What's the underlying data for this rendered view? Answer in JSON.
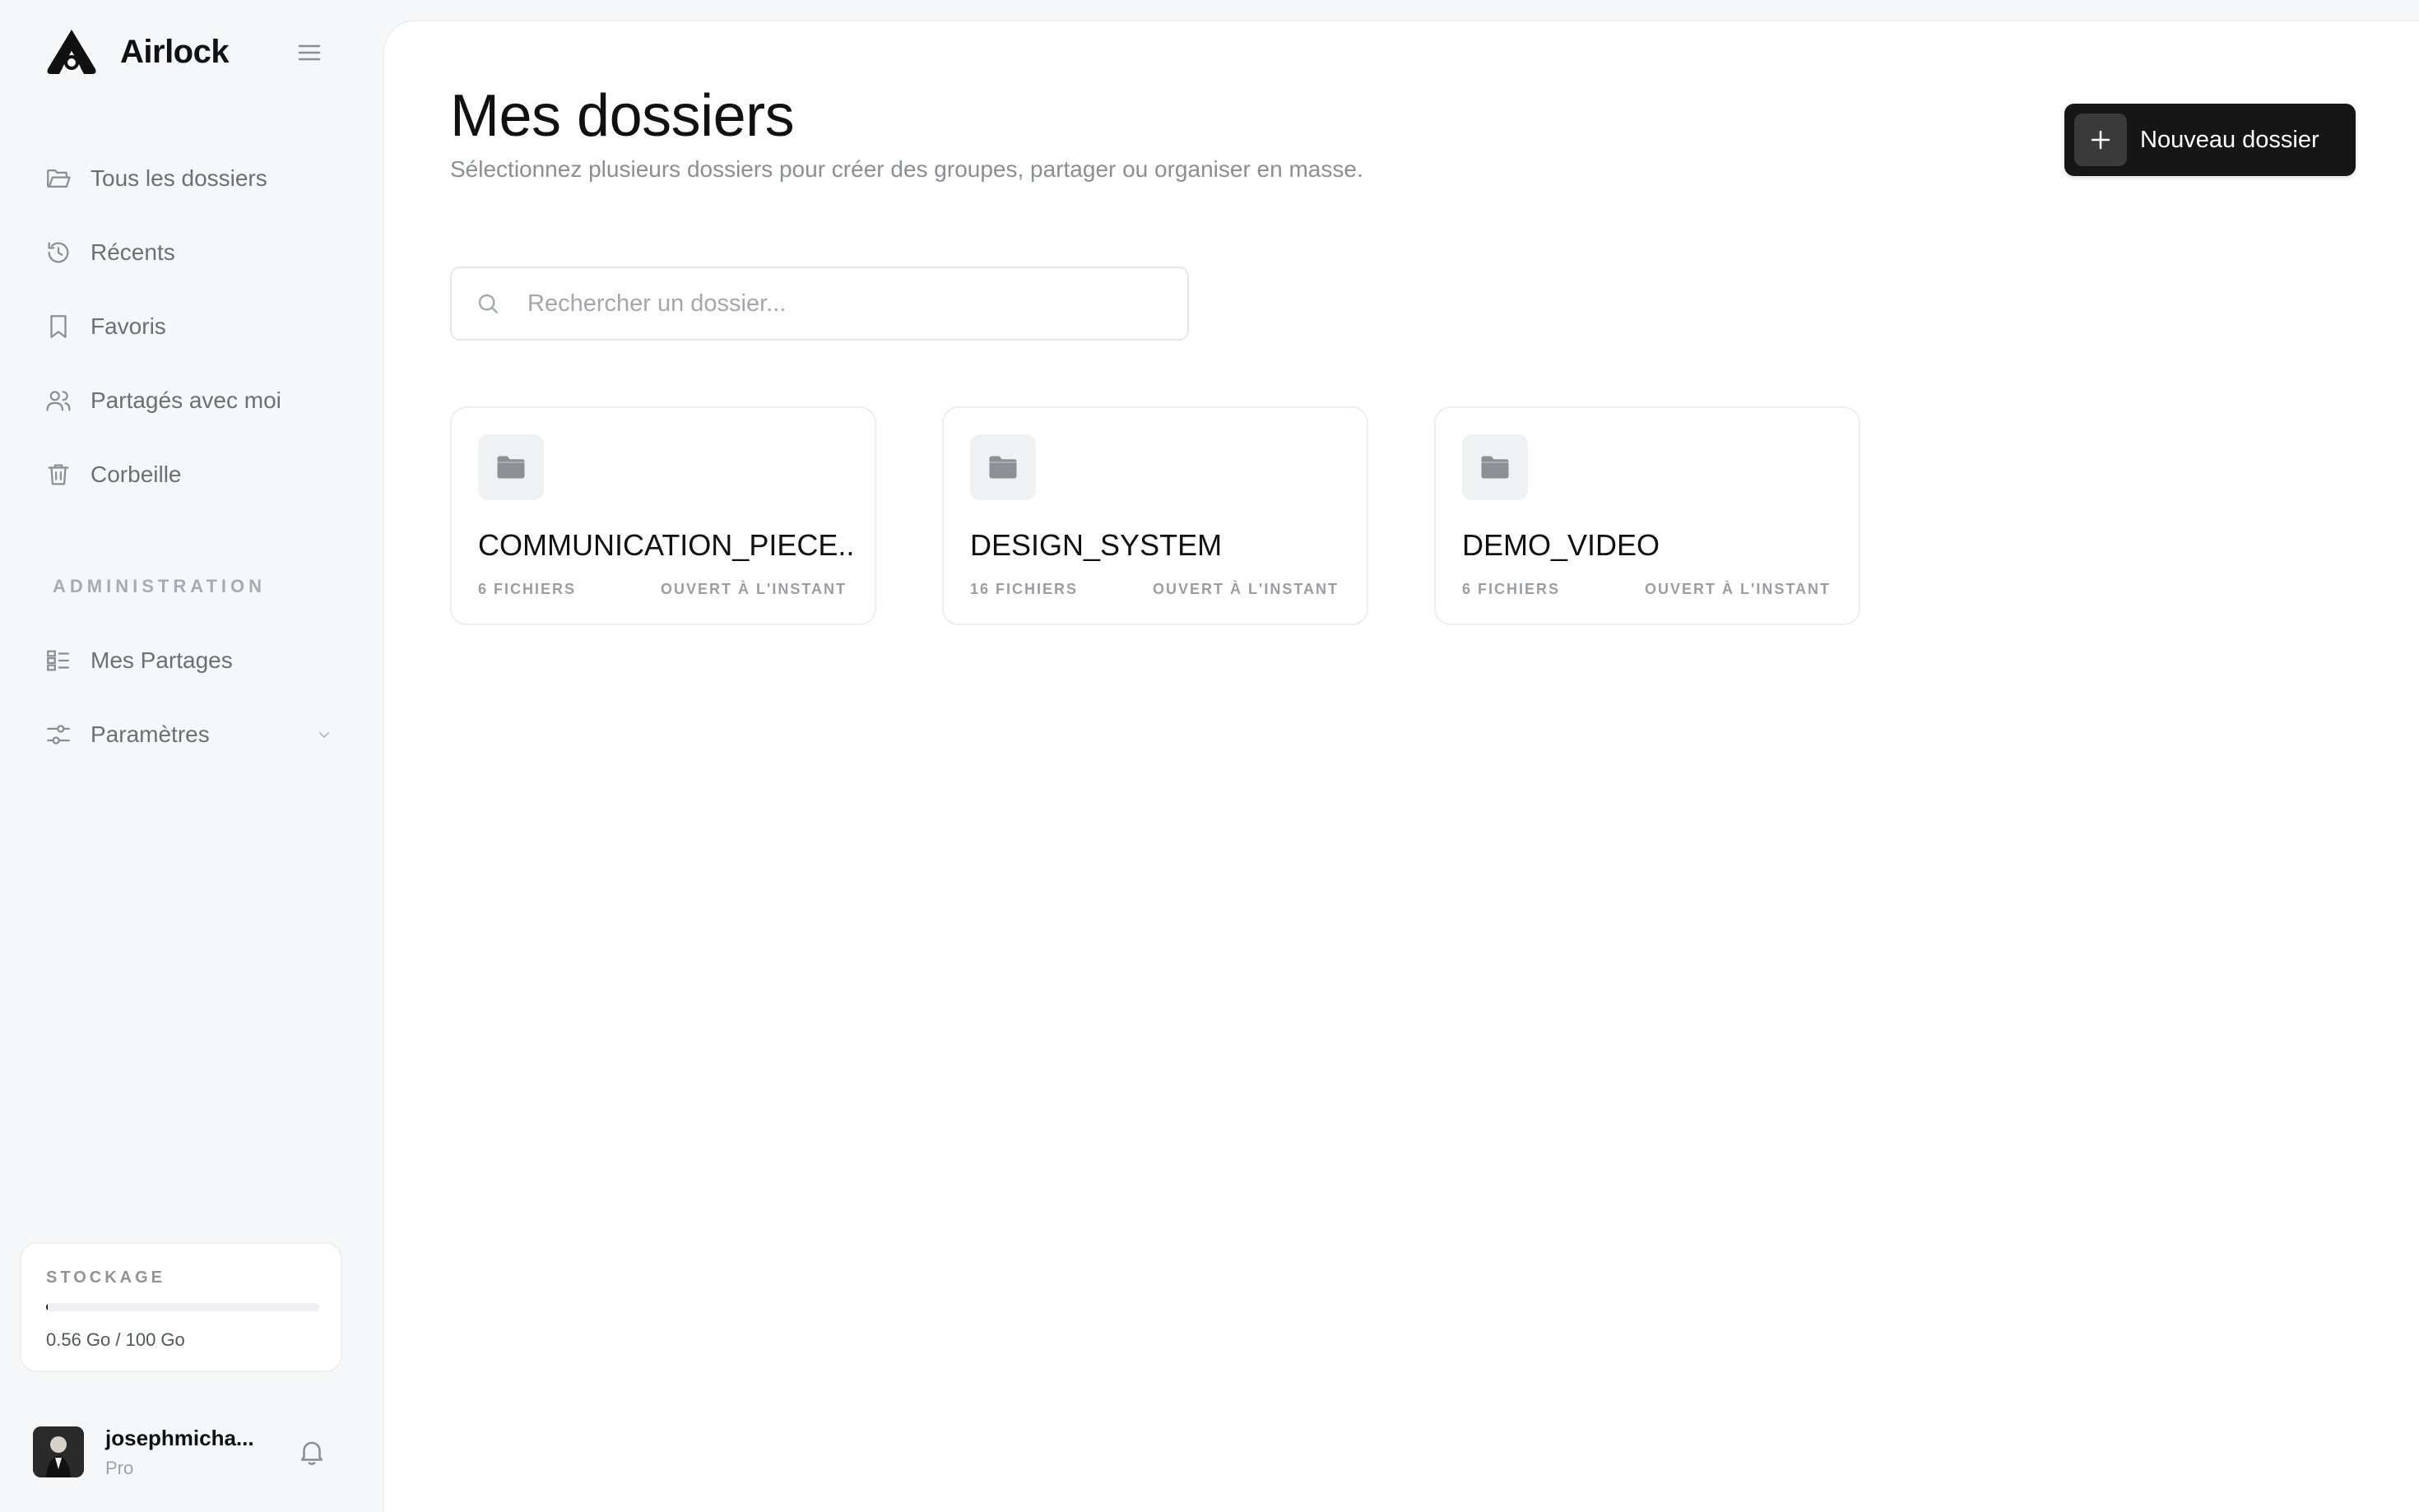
{
  "brand": {
    "name": "Airlock"
  },
  "sidebar": {
    "items": [
      {
        "label": "Tous les dossiers",
        "icon": "folder-open-icon"
      },
      {
        "label": "Récents",
        "icon": "history-icon"
      },
      {
        "label": "Favoris",
        "icon": "bookmark-icon"
      },
      {
        "label": "Partagés avec moi",
        "icon": "users-icon"
      },
      {
        "label": "Corbeille",
        "icon": "trash-icon"
      }
    ],
    "section_label": "ADMINISTRATION",
    "admin_items": [
      {
        "label": "Mes Partages",
        "icon": "list-icon"
      },
      {
        "label": "Paramètres",
        "icon": "sliders-icon"
      }
    ]
  },
  "storage": {
    "title": "STOCKAGE",
    "text": "0.56 Go / 100 Go",
    "used_fraction": 0.0056
  },
  "user": {
    "name": "josephmicha...",
    "plan": "Pro"
  },
  "main": {
    "title": "Mes dossiers",
    "subtitle": "Sélectionnez plusieurs dossiers pour créer des groupes, partager ou organiser en masse.",
    "new_button": "Nouveau dossier",
    "search_placeholder": "Rechercher un dossier...",
    "folders": [
      {
        "name": "COMMUNICATION_PIECE...",
        "files": "6 FICHIERS",
        "opened": "OUVERT À L'INSTANT"
      },
      {
        "name": "DESIGN_SYSTEM",
        "files": "16 FICHIERS",
        "opened": "OUVERT À L'INSTANT"
      },
      {
        "name": "DEMO_VIDEO",
        "files": "6 FICHIERS",
        "opened": "OUVERT À L'INSTANT"
      }
    ]
  },
  "colors": {
    "accent": "#161616",
    "muted_text": "#6b6f76",
    "background": "#f6f7f9"
  }
}
